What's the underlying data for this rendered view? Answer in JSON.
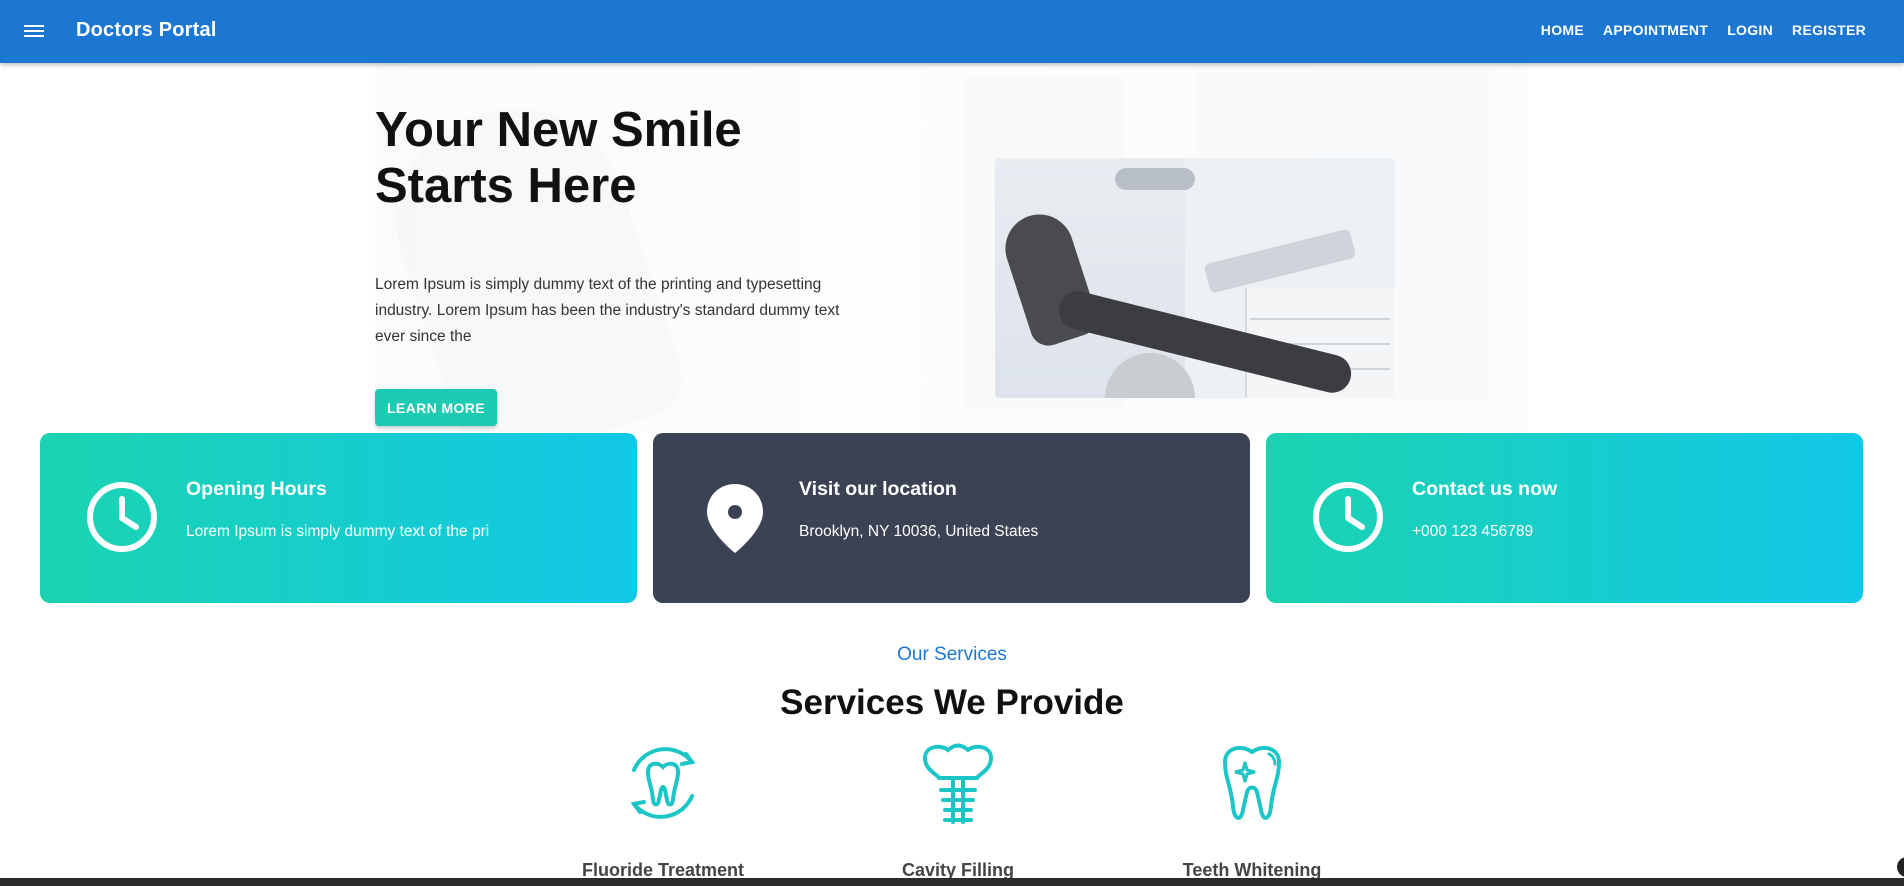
{
  "app": {
    "title": "Doctors Portal"
  },
  "nav": {
    "items": [
      {
        "label": "HOME"
      },
      {
        "label": "APPOINTMENT"
      },
      {
        "label": "LOGIN"
      },
      {
        "label": "REGISTER"
      }
    ]
  },
  "hero": {
    "title_line1": "Your New Smile",
    "title_line2": "Starts Here",
    "text": "Lorem Ipsum is simply dummy text of the printing and typesetting industry. Lorem Ipsum has been the industry's standard dummy text ever since the",
    "button_label": "LEARN MORE"
  },
  "info_cards": [
    {
      "title": "Opening Hours",
      "desc": "Lorem Ipsum is simply dummy text of the pri",
      "icon": "clock-icon"
    },
    {
      "title": "Visit our location",
      "desc": "Brooklyn, NY 10036, United States",
      "icon": "location-pin-icon"
    },
    {
      "title": "Contact us now",
      "desc": "+000 123 456789",
      "icon": "clock-icon"
    }
  ],
  "services": {
    "subtitle": "Our Services",
    "title": "Services We Provide",
    "items": [
      {
        "label": "Fluoride Treatment",
        "icon": "tooth-refresh-icon"
      },
      {
        "label": "Cavity Filling",
        "icon": "tooth-implant-icon"
      },
      {
        "label": "Teeth Whitening",
        "icon": "tooth-sparkle-icon"
      }
    ]
  },
  "colors": {
    "appbar": "#1b77d2",
    "accent": "#1ccbb2",
    "card_dark": "#3b4254",
    "teal_icon": "#1cc6c6"
  }
}
